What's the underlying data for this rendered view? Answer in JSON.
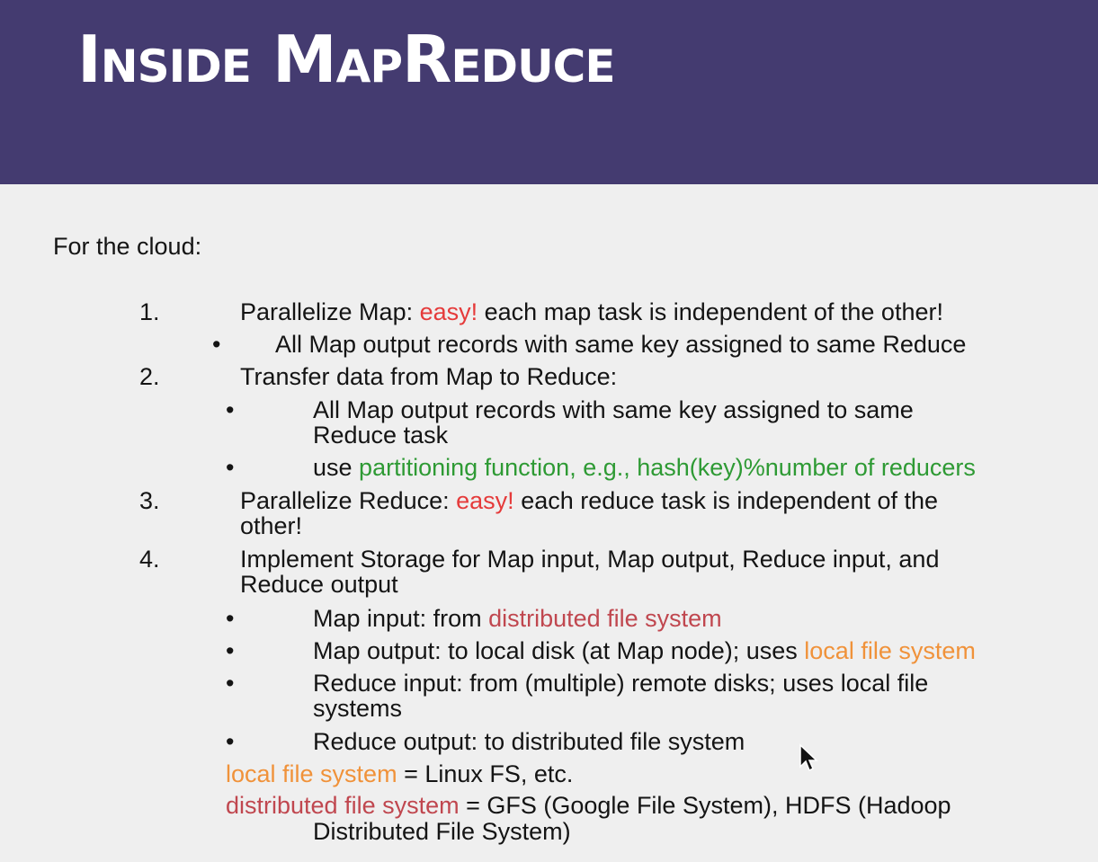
{
  "slide": {
    "title": "Inside MapReduce",
    "intro": "For the cloud:",
    "items": [
      {
        "num": "1.",
        "pre": "Parallelize Map: ",
        "em": "easy!",
        "post": " each map task is independent of the other!",
        "bullets": [
          {
            "bullet": "•",
            "text": "All Map output records with same key assigned to same Reduce"
          }
        ]
      },
      {
        "num": "2.",
        "text": "Transfer data from Map to Reduce:",
        "bullets": [
          {
            "bullet": "•",
            "line1": "All Map output records with same key assigned to same",
            "line2": "Reduce task"
          },
          {
            "bullet": "•",
            "pre": "use ",
            "em": "partitioning function, e.g., hash(key)%number of reducers"
          }
        ]
      },
      {
        "num": "3.",
        "pre": "Parallelize Reduce: ",
        "em": "easy!",
        "post": " each reduce task is independent of the",
        "line2": "other!"
      },
      {
        "num": "4.",
        "line1": "Implement Storage for Map input, Map output, Reduce input, and",
        "line2": "Reduce output",
        "bullets": [
          {
            "bullet": "•",
            "pre": "Map input: from ",
            "em": "distributed file system"
          },
          {
            "bullet": "•",
            "pre": "Map output: to local disk (at Map node); uses ",
            "em": "local file system"
          },
          {
            "bullet": "•",
            "line1": "Reduce input: from (multiple) remote disks; uses local file",
            "line2": "systems"
          },
          {
            "bullet": "•",
            "text": "Reduce output: to distributed file system"
          }
        ]
      }
    ],
    "notes": [
      {
        "em": "local file system",
        "rest": " = Linux FS, etc."
      },
      {
        "em": "distributed file system",
        "rest": " = GFS (Google File System), HDFS (Hadoop",
        "line2": "Distributed File System)"
      }
    ]
  },
  "colors": {
    "header": "#443b70",
    "background": "#efefef",
    "easy": "#e53a3a",
    "partitioning": "#2e9a34",
    "distributed_fs": "#c0474f",
    "local_fs": "#f0923a"
  },
  "icons": {
    "cursor": "mouse-pointer-icon"
  }
}
